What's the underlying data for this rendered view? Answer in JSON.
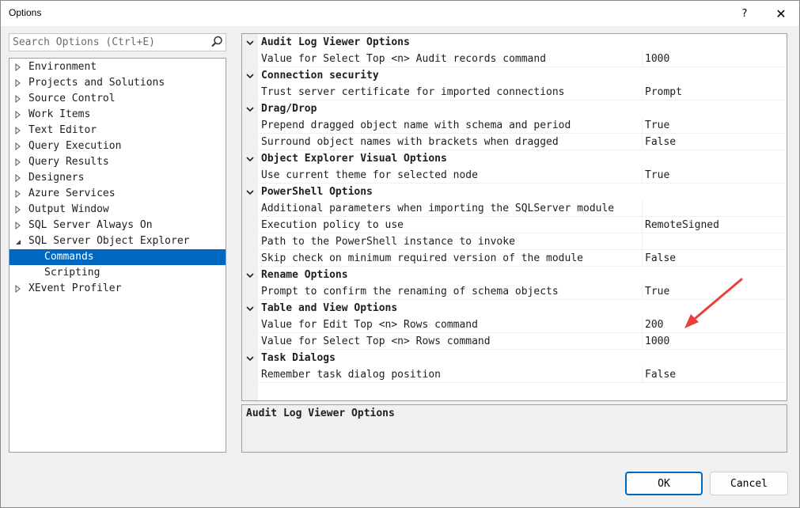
{
  "window": {
    "title": "Options",
    "help_glyph": "?",
    "close_glyph": "✕"
  },
  "search": {
    "placeholder": "Search Options (Ctrl+E)",
    "value": ""
  },
  "tree": {
    "items": [
      {
        "label": "Environment",
        "expanded": false
      },
      {
        "label": "Projects and Solutions",
        "expanded": false
      },
      {
        "label": "Source Control",
        "expanded": false
      },
      {
        "label": "Work Items",
        "expanded": false
      },
      {
        "label": "Text Editor",
        "expanded": false
      },
      {
        "label": "Query Execution",
        "expanded": false
      },
      {
        "label": "Query Results",
        "expanded": false
      },
      {
        "label": "Designers",
        "expanded": false
      },
      {
        "label": "Azure Services",
        "expanded": false
      },
      {
        "label": "Output Window",
        "expanded": false
      },
      {
        "label": "SQL Server Always On",
        "expanded": false
      },
      {
        "label": "SQL Server Object Explorer",
        "expanded": true
      },
      {
        "label": "Commands",
        "child": true,
        "selected": true
      },
      {
        "label": "Scripting",
        "child": true
      },
      {
        "label": "XEvent Profiler",
        "expanded": false
      }
    ]
  },
  "grid": {
    "rows": [
      {
        "type": "category",
        "label": "Audit Log Viewer Options"
      },
      {
        "type": "property",
        "name": "Value for Select Top <n> Audit records command",
        "value": "1000"
      },
      {
        "type": "category",
        "label": "Connection security"
      },
      {
        "type": "property",
        "name": "Trust server certificate for imported connections",
        "value": "Prompt"
      },
      {
        "type": "category",
        "label": "Drag/Drop"
      },
      {
        "type": "property",
        "name": "Prepend dragged object name with schema and period",
        "value": "True"
      },
      {
        "type": "property",
        "name": "Surround object names with brackets when dragged",
        "value": "False"
      },
      {
        "type": "category",
        "label": "Object Explorer Visual Options"
      },
      {
        "type": "property",
        "name": "Use current theme for selected node",
        "value": "True"
      },
      {
        "type": "category",
        "label": "PowerShell Options"
      },
      {
        "type": "property",
        "name": "Additional parameters when importing the SQLServer module",
        "value": ""
      },
      {
        "type": "property",
        "name": "Execution policy to use",
        "value": "RemoteSigned"
      },
      {
        "type": "property",
        "name": "Path to the PowerShell instance to invoke",
        "value": ""
      },
      {
        "type": "property",
        "name": "Skip check on minimum required version of the module",
        "value": "False"
      },
      {
        "type": "category",
        "label": "Rename Options"
      },
      {
        "type": "property",
        "name": "Prompt to confirm the renaming of schema objects",
        "value": "True"
      },
      {
        "type": "category",
        "label": "Table and View Options"
      },
      {
        "type": "property",
        "name": "Value for Edit Top <n> Rows command",
        "value": "200"
      },
      {
        "type": "property",
        "name": "Value for Select Top <n> Rows command",
        "value": "1000"
      },
      {
        "type": "category",
        "label": "Task Dialogs"
      },
      {
        "type": "property",
        "name": "Remember task dialog position",
        "value": "False"
      }
    ]
  },
  "description": {
    "title": "Audit Log Viewer Options"
  },
  "buttons": {
    "ok": "OK",
    "cancel": "Cancel"
  },
  "colors": {
    "accent": "#0067c0",
    "annotation_arrow": "#e8413a"
  }
}
